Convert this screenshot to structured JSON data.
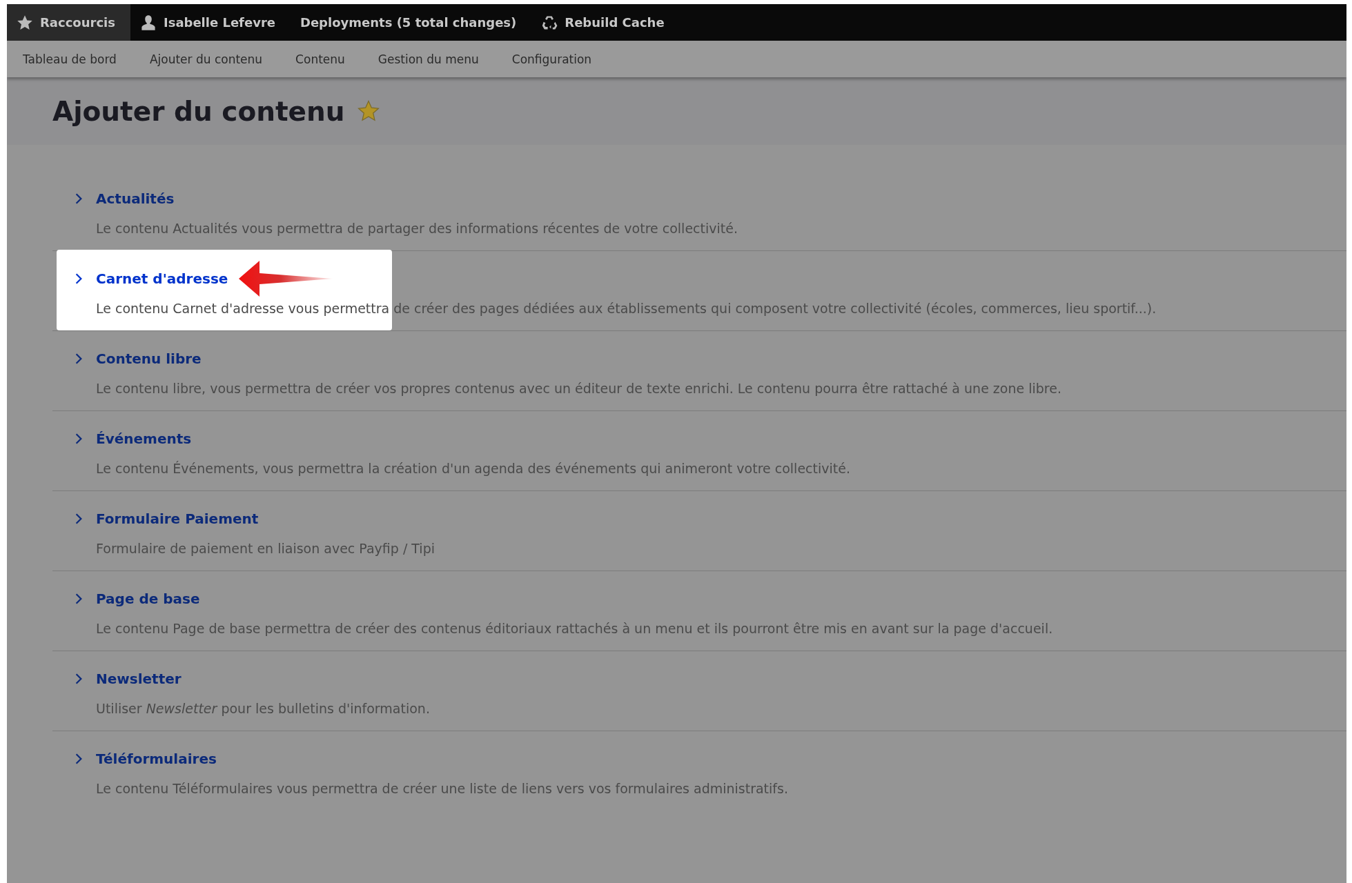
{
  "toolbar": {
    "items": [
      {
        "label": "Raccourcis",
        "kind": "shortcuts",
        "selected": true
      },
      {
        "label": "Isabelle Lefevre",
        "kind": "account",
        "selected": false
      },
      {
        "label": "Deployments (5 total changes)",
        "kind": "text",
        "selected": false
      },
      {
        "label": "Rebuild Cache",
        "kind": "cache",
        "selected": false
      }
    ]
  },
  "admin_menu": {
    "items": [
      "Tableau de bord",
      "Ajouter du contenu",
      "Contenu",
      "Gestion du menu",
      "Configuration"
    ]
  },
  "page": {
    "title": "Ajouter du contenu",
    "favorite": true
  },
  "content_types": [
    {
      "title": "Actualités",
      "description": "Le contenu Actualités vous permettra de partager des informations récentes de votre collectivité.",
      "highlighted": false
    },
    {
      "title": "Carnet d'adresse",
      "description": "Le contenu Carnet d'adresse vous permettra de créer des pages dédiées aux établissements qui composent votre collectivité (écoles, commerces, lieu sportif...).",
      "highlighted": true
    },
    {
      "title": "Contenu libre",
      "description": "Le contenu libre, vous permettra de créer vos propres contenus avec un éditeur de texte enrichi. Le contenu pourra être rattaché à une zone libre.",
      "highlighted": false
    },
    {
      "title": "Événements",
      "description": "Le contenu Événements, vous permettra la création d'un agenda des événements qui animeront votre collectivité.",
      "highlighted": false
    },
    {
      "title": "Formulaire Paiement",
      "description": "Formulaire de paiement en liaison avec Payfip / Tipi",
      "highlighted": false
    },
    {
      "title": "Page de base",
      "description": "Le contenu Page de base permettra de créer des contenus éditoriaux rattachés à un menu et ils pourront être mis en avant sur la page d'accueil.",
      "highlighted": false
    },
    {
      "title": "Newsletter",
      "description": "Utiliser *Newsletter* pour les bulletins d'information.",
      "highlighted": false
    },
    {
      "title": "Téléformulaires",
      "description": "Le contenu Téléformulaires vous permettra de créer une liste de liens vers vos formulaires administratifs.",
      "highlighted": false
    }
  ]
}
